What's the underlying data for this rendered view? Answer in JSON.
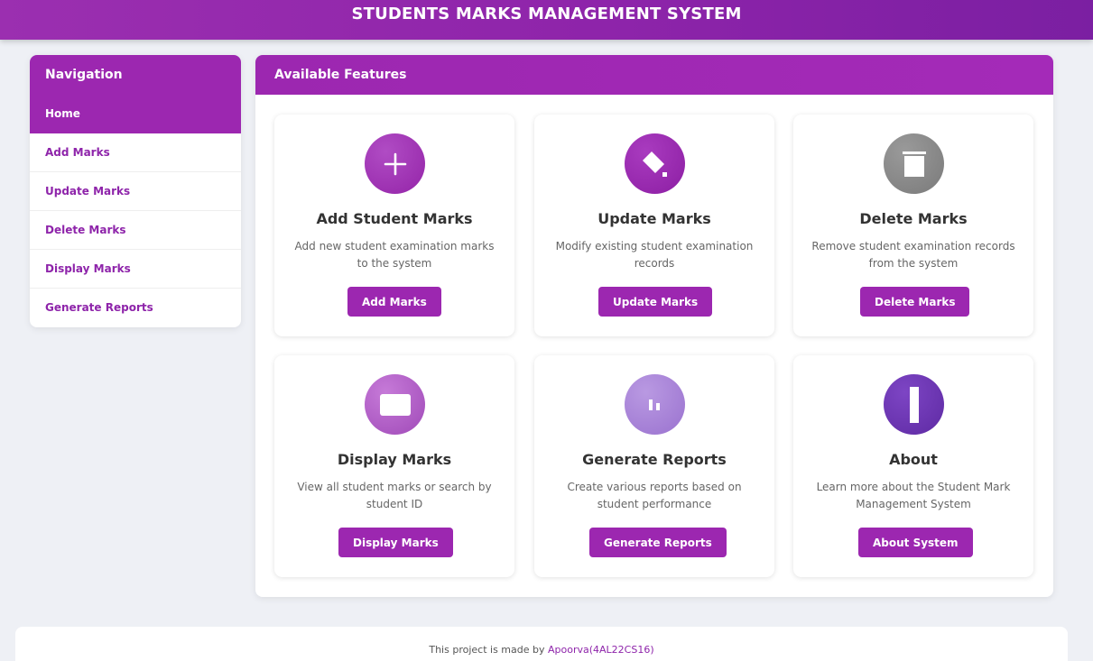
{
  "app": {
    "title": "STUDENTS MARKS MANAGEMENT SYSTEM"
  },
  "sidebar": {
    "heading": "Navigation",
    "items": [
      {
        "label": "Home",
        "active": true
      },
      {
        "label": "Add Marks"
      },
      {
        "label": "Update Marks"
      },
      {
        "label": "Delete Marks"
      },
      {
        "label": "Display Marks"
      },
      {
        "label": "Generate Reports"
      }
    ]
  },
  "main": {
    "heading": "Available Features",
    "cards": [
      {
        "title": "Add Student Marks",
        "description": "Add new student examination marks to the system",
        "button": "Add Marks",
        "icon": "plus-icon",
        "color": "#9c27b0"
      },
      {
        "title": "Update Marks",
        "description": "Modify existing student examination records",
        "button": "Update Marks",
        "icon": "edit-icon",
        "color": "#9c27b0"
      },
      {
        "title": "Delete Marks",
        "description": "Remove student examination records from the system",
        "button": "Delete Marks",
        "icon": "trash-icon",
        "color": "#8a8a8a"
      },
      {
        "title": "Display Marks",
        "description": "View all student marks or search by student ID",
        "button": "Display Marks",
        "icon": "display-icon",
        "color": "#b25fc9"
      },
      {
        "title": "Generate Reports",
        "description": "Create various reports based on student performance",
        "button": "Generate Reports",
        "icon": "chart-icon",
        "color": "#a77fd6"
      },
      {
        "title": "About",
        "description": "Learn more about the Student Mark Management System",
        "button": "About System",
        "icon": "info-icon",
        "color": "#6a35b3"
      }
    ]
  },
  "footer": {
    "text": "This project is made by",
    "author": "Apoorva(4AL22CS16)"
  },
  "colors": {
    "accent": "#9c27b0",
    "background": "#eef0f5"
  }
}
